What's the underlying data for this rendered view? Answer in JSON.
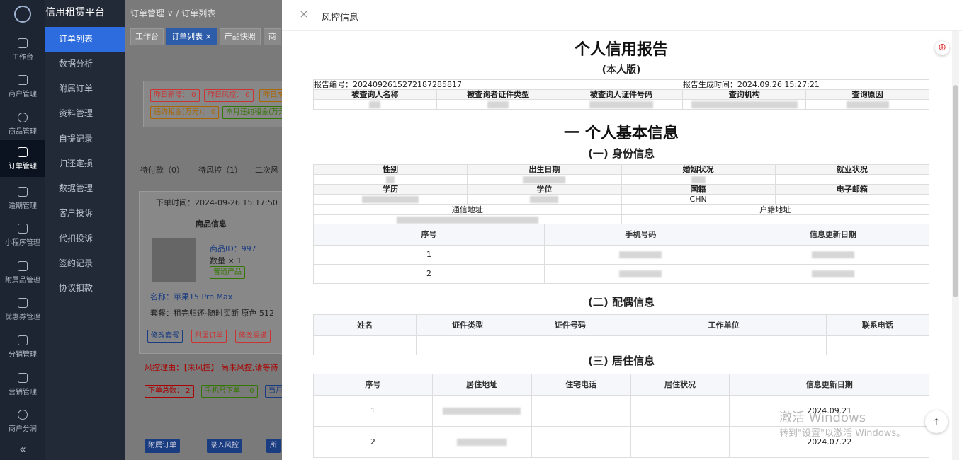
{
  "brand": "信用租赁平台",
  "nav": [
    {
      "label": "工作台",
      "icon": "home-icon"
    },
    {
      "label": "商户管理",
      "icon": "bag-icon"
    },
    {
      "label": "商品管理",
      "icon": "apple-icon"
    },
    {
      "label": "订单管理",
      "icon": "trophy-icon"
    },
    {
      "label": "逾期管理",
      "icon": "alarm-icon"
    },
    {
      "label": "小程序管理",
      "icon": "watch-icon"
    },
    {
      "label": "附属品管理",
      "icon": "cart-icon"
    },
    {
      "label": "优惠券管理",
      "icon": "gift-icon"
    },
    {
      "label": "分销管理",
      "icon": "chart-icon"
    },
    {
      "label": "营销管理",
      "icon": "megaphone-icon"
    },
    {
      "label": "商户分润",
      "icon": "coin-icon"
    }
  ],
  "collapse": "«",
  "submenu": [
    "订单列表",
    "数据分析",
    "附属订单",
    "资料管理",
    "自提记录",
    "归还定损",
    "数据管理",
    "客户投诉",
    "代扣投诉",
    "签约记录",
    "协议扣款"
  ],
  "breadcrumb": "订单管理 ∨  /  订单列表",
  "tabs": [
    "工作台",
    "订单列表 ×",
    "产品快照",
    "商"
  ],
  "stats": {
    "row1": [
      "昨日新增：  0",
      "昨日风控：  0",
      "昨日成"
    ],
    "row2": [
      "违约租金(万元)：  0",
      "本月违约租金(万元"
    ]
  },
  "status_tabs": [
    "待付款（0）",
    "待风控（1）",
    "二次风"
  ],
  "order": {
    "time": "下单时间：2024-09-26 15:17:50",
    "info_header": "商品信息",
    "product_id": "商品ID：997",
    "qty": "数量 × 1",
    "tag": "普通产品",
    "name": "名称：苹果15 Pro Max",
    "package": "套餐：租完归还-随时买断 原色 512",
    "btns": [
      "修改套餐",
      "附属订单",
      "修改渠道"
    ],
    "risk": "风控理由：【未风控】 尚未风控,请等待",
    "counts": [
      "下单总数：  2",
      "手机号下单：  0",
      "当月"
    ],
    "actions": [
      "附属订单",
      "录入风控",
      "所"
    ]
  },
  "panel": {
    "title": "风控信息",
    "close": "×"
  },
  "report": {
    "title": "个人信用报告",
    "edition": "(本人版)",
    "number": "报告编号：2024092615272187285817",
    "gen_time": "报告生成时间：2024.09.26 15:27:21",
    "query_cols": [
      "被查询人名称",
      "被查询者证件类型",
      "被查询人证件号码",
      "查询机构",
      "查询原因"
    ],
    "sec1": "一 个人基本信息",
    "sub1": "(一) 身份信息",
    "identity_cols1": [
      "性别",
      "出生日期",
      "婚姻状况",
      "就业状况"
    ],
    "identity_cols2": [
      "学历",
      "学位",
      "国籍",
      "电子邮箱"
    ],
    "nationality": "CHN",
    "addr_cols": [
      "通信地址",
      "户籍地址"
    ],
    "phone_cols": [
      "序号",
      "手机号码",
      "信息更新日期"
    ],
    "phone_rows": [
      "1",
      "2"
    ],
    "sub2": "(二) 配偶信息",
    "spouse_cols": [
      "姓名",
      "证件类型",
      "证件号码",
      "工作单位",
      "联系电话"
    ],
    "sub3": "(三) 居住信息",
    "res_cols": [
      "序号",
      "居住地址",
      "住宅电话",
      "居住状况",
      "信息更新日期"
    ],
    "res_rows": [
      {
        "no": "1",
        "date": "2024.09.21"
      },
      {
        "no": "2",
        "date": "2024.07.22"
      }
    ]
  },
  "watermark": {
    "line1": "激活 Windows",
    "line2": "转到\"设置\"以激活 Windows。"
  },
  "colors": {
    "nav_bg": "#1d2432",
    "active": "#2d6cdf",
    "danger": "#e23b3b"
  }
}
